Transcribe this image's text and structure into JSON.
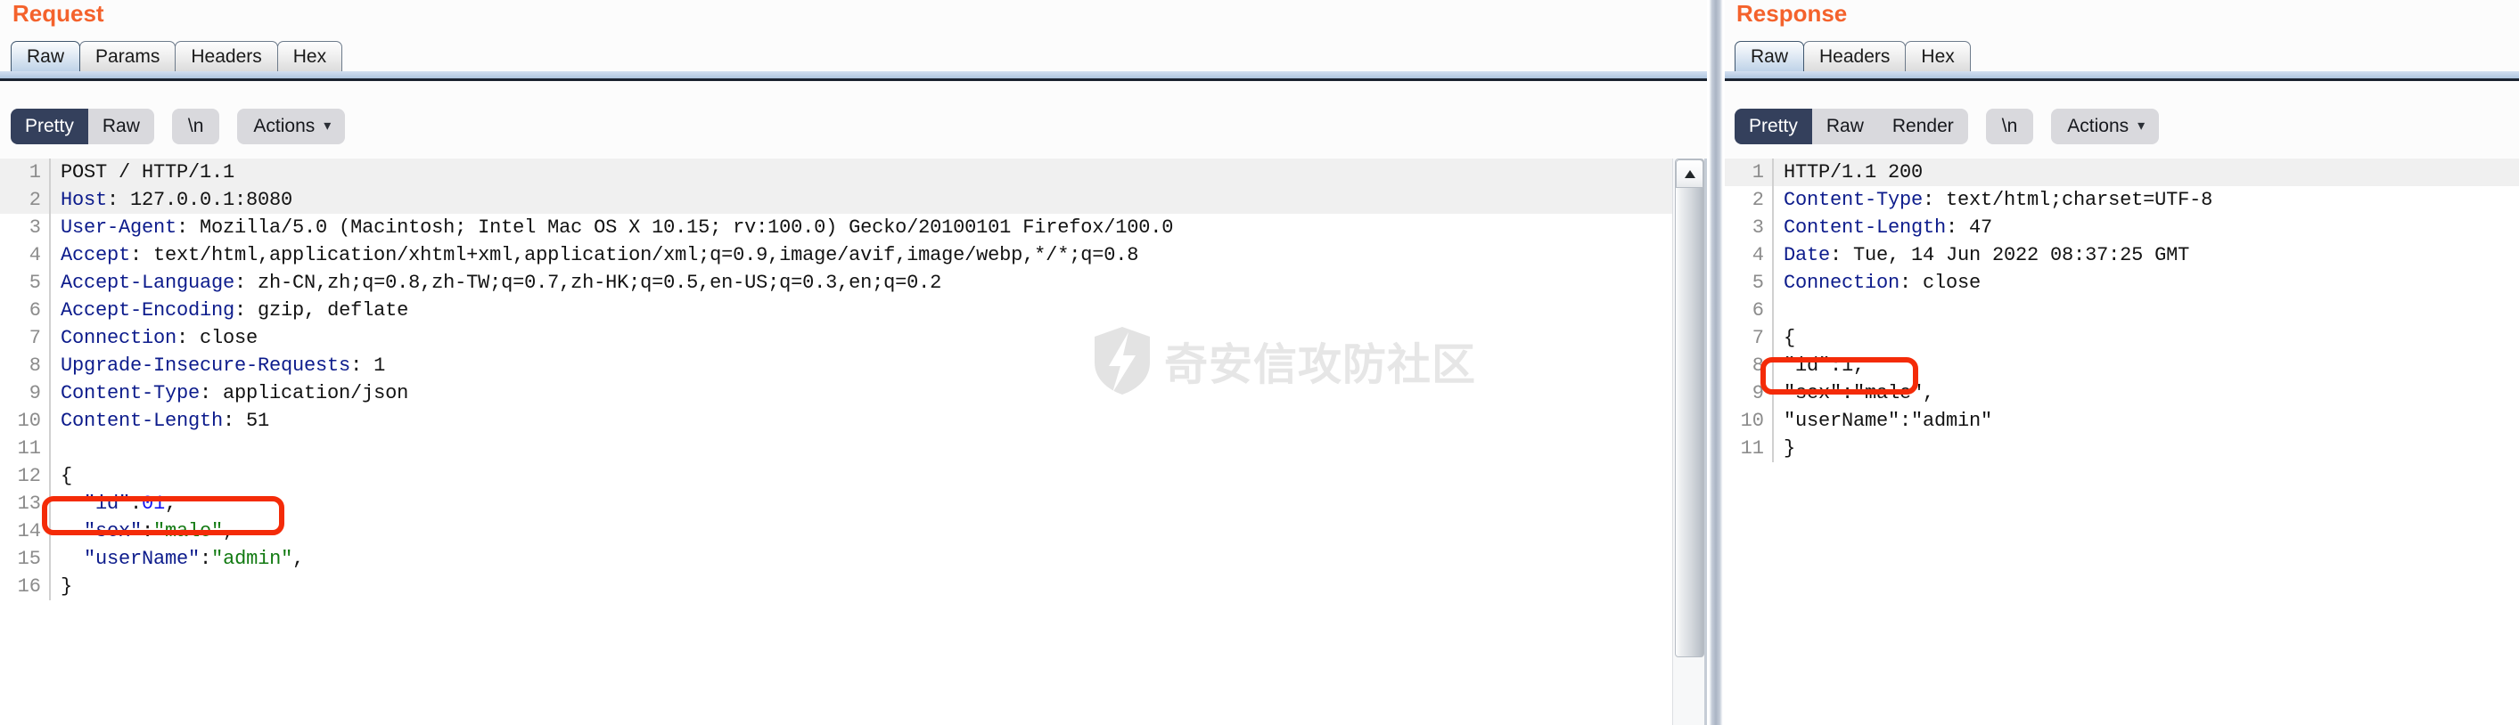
{
  "request": {
    "title": "Request",
    "tabs": [
      {
        "label": "Raw",
        "selected": true
      },
      {
        "label": "Params",
        "selected": false
      },
      {
        "label": "Headers",
        "selected": false
      },
      {
        "label": "Hex",
        "selected": false
      }
    ],
    "toolbar": {
      "pretty_label": "Pretty",
      "raw_label": "Raw",
      "newline_label": "\\n",
      "actions_label": "Actions",
      "caret_icon": "chevron-down-icon",
      "selected_view": "Pretty"
    },
    "lines": [
      {
        "n": "1",
        "highlight": true,
        "parts": [
          {
            "t": "POST / HTTP/1.1",
            "c": "plain"
          }
        ]
      },
      {
        "n": "2",
        "highlight": true,
        "parts": [
          {
            "t": "Host",
            "c": "hdr"
          },
          {
            "t": ": 127.0.0.1:8080",
            "c": "val"
          }
        ]
      },
      {
        "n": "3",
        "highlight": false,
        "parts": [
          {
            "t": "User-Agent",
            "c": "hdr"
          },
          {
            "t": ": Mozilla/5.0 (Macintosh; Intel Mac OS X 10.15; rv:100.0) Gecko/20100101 Firefox/100.0",
            "c": "val"
          }
        ]
      },
      {
        "n": "4",
        "highlight": false,
        "parts": [
          {
            "t": "Accept",
            "c": "hdr"
          },
          {
            "t": ": text/html,application/xhtml+xml,application/xml;q=0.9,image/avif,image/webp,*/*;q=0.8",
            "c": "val"
          }
        ]
      },
      {
        "n": "5",
        "highlight": false,
        "parts": [
          {
            "t": "Accept-Language",
            "c": "hdr"
          },
          {
            "t": ": zh-CN,zh;q=0.8,zh-TW;q=0.7,zh-HK;q=0.5,en-US;q=0.3,en;q=0.2",
            "c": "val"
          }
        ]
      },
      {
        "n": "6",
        "highlight": false,
        "parts": [
          {
            "t": "Accept-Encoding",
            "c": "hdr"
          },
          {
            "t": ": gzip, deflate",
            "c": "val"
          }
        ]
      },
      {
        "n": "7",
        "highlight": false,
        "parts": [
          {
            "t": "Connection",
            "c": "hdr"
          },
          {
            "t": ": close",
            "c": "val"
          }
        ]
      },
      {
        "n": "8",
        "highlight": false,
        "parts": [
          {
            "t": "Upgrade-Insecure-Requests",
            "c": "hdr"
          },
          {
            "t": ": 1",
            "c": "val"
          }
        ]
      },
      {
        "n": "9",
        "highlight": false,
        "parts": [
          {
            "t": "Content-Type",
            "c": "hdr"
          },
          {
            "t": ": application/json",
            "c": "val"
          }
        ]
      },
      {
        "n": "10",
        "highlight": false,
        "parts": [
          {
            "t": "Content-Length",
            "c": "hdr"
          },
          {
            "t": ": 51",
            "c": "val"
          }
        ]
      },
      {
        "n": "11",
        "highlight": false,
        "parts": [
          {
            "t": "",
            "c": "plain"
          }
        ]
      },
      {
        "n": "12",
        "highlight": false,
        "parts": [
          {
            "t": "{",
            "c": "plain"
          }
        ]
      },
      {
        "n": "13",
        "highlight": false,
        "parts": [
          {
            "t": "  ",
            "c": "plain"
          },
          {
            "t": "\"id\"",
            "c": "jkey"
          },
          {
            "t": ":",
            "c": "plain"
          },
          {
            "t": "01",
            "c": "jnum"
          },
          {
            "t": ",",
            "c": "plain"
          }
        ]
      },
      {
        "n": "14",
        "highlight": false,
        "parts": [
          {
            "t": "  ",
            "c": "plain"
          },
          {
            "t": "\"sex\"",
            "c": "jkey"
          },
          {
            "t": ":",
            "c": "plain"
          },
          {
            "t": "\"male\"",
            "c": "jstr"
          },
          {
            "t": ",",
            "c": "plain"
          }
        ]
      },
      {
        "n": "15",
        "highlight": false,
        "parts": [
          {
            "t": "  ",
            "c": "plain"
          },
          {
            "t": "\"userName\"",
            "c": "jkey"
          },
          {
            "t": ":",
            "c": "plain"
          },
          {
            "t": "\"admin\"",
            "c": "jstr"
          },
          {
            "t": ",",
            "c": "plain"
          }
        ]
      },
      {
        "n": "16",
        "highlight": false,
        "parts": [
          {
            "t": "}",
            "c": "plain"
          }
        ]
      }
    ],
    "scrollbar": {
      "up_arrow_icon": "triangle-up-icon"
    },
    "annotation": {
      "label": "red-highlight-box-id-01"
    }
  },
  "response": {
    "title": "Response",
    "tabs": [
      {
        "label": "Raw",
        "selected": true
      },
      {
        "label": "Headers",
        "selected": false
      },
      {
        "label": "Hex",
        "selected": false
      }
    ],
    "toolbar": {
      "pretty_label": "Pretty",
      "raw_label": "Raw",
      "render_label": "Render",
      "newline_label": "\\n",
      "actions_label": "Actions",
      "caret_icon": "chevron-down-icon",
      "selected_view": "Pretty"
    },
    "lines": [
      {
        "n": "1",
        "highlight": true,
        "parts": [
          {
            "t": "HTTP/1.1 200",
            "c": "plain"
          }
        ]
      },
      {
        "n": "2",
        "highlight": false,
        "parts": [
          {
            "t": "Content-Type",
            "c": "hdr"
          },
          {
            "t": ": text/html;charset=UTF-8",
            "c": "val"
          }
        ]
      },
      {
        "n": "3",
        "highlight": false,
        "parts": [
          {
            "t": "Content-Length",
            "c": "hdr"
          },
          {
            "t": ": 47",
            "c": "val"
          }
        ]
      },
      {
        "n": "4",
        "highlight": false,
        "parts": [
          {
            "t": "Date",
            "c": "hdr"
          },
          {
            "t": ": Tue, 14 Jun 2022 08:37:25 GMT",
            "c": "val"
          }
        ]
      },
      {
        "n": "5",
        "highlight": false,
        "parts": [
          {
            "t": "Connection",
            "c": "hdr"
          },
          {
            "t": ": close",
            "c": "val"
          }
        ]
      },
      {
        "n": "6",
        "highlight": false,
        "parts": [
          {
            "t": "",
            "c": "plain"
          }
        ]
      },
      {
        "n": "7",
        "highlight": false,
        "parts": [
          {
            "t": "{",
            "c": "plain"
          }
        ]
      },
      {
        "n": "8",
        "highlight": false,
        "parts": [
          {
            "t": "\"id\":1,",
            "c": "plain"
          }
        ]
      },
      {
        "n": "9",
        "highlight": false,
        "parts": [
          {
            "t": "\"sex\":\"male\",",
            "c": "plain"
          }
        ]
      },
      {
        "n": "10",
        "highlight": false,
        "parts": [
          {
            "t": "\"userName\":\"admin\"",
            "c": "plain"
          }
        ]
      },
      {
        "n": "11",
        "highlight": false,
        "parts": [
          {
            "t": "}",
            "c": "plain"
          }
        ]
      }
    ],
    "annotation": {
      "label": "red-highlight-box-id-1"
    }
  },
  "watermark": {
    "text": "奇安信攻防社区",
    "logo_icon": "shield-bolt-logo-icon",
    "color": "#e6e6e6"
  },
  "colors": {
    "title_orange": "#f4622c",
    "header_blue": "#0d1c8c",
    "json_string_green": "#127a12",
    "json_number_blue": "#1414f0",
    "annotation_red": "#f42b08",
    "active_segment": "#34405c"
  }
}
